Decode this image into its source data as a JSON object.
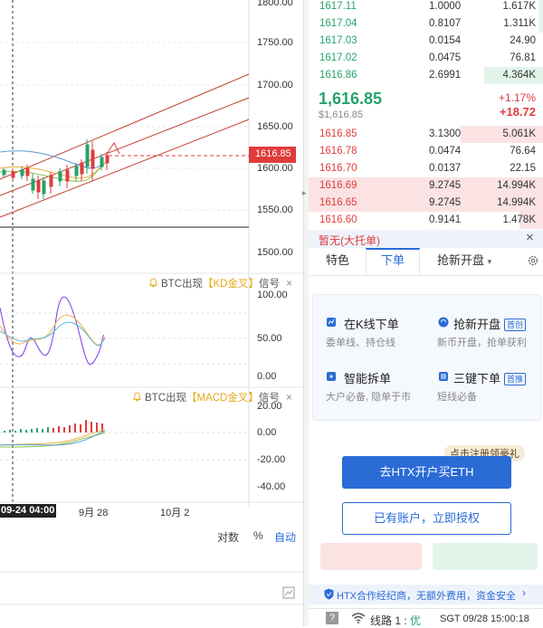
{
  "chart": {
    "price_axis": [
      "1800.00",
      "1750.00",
      "1700.00",
      "1650.00",
      "1600.00",
      "1550.00",
      "1500.00"
    ],
    "current_price_label": "1616.85",
    "kd_signal": {
      "prefix": "BTC出现",
      "highlight": "【KD金叉】",
      "suffix": "信号",
      "close": "×"
    },
    "kd_axis": [
      "100.00",
      "50.00",
      "0.00"
    ],
    "macd_signal": {
      "prefix": "BTC出现",
      "highlight": "【MACD金叉】",
      "suffix": "信号",
      "close": "×"
    },
    "macd_axis": [
      "20.00",
      "0.00",
      "-20.00",
      "-40.00"
    ],
    "time_axis": {
      "cursor": "09-24 04:00",
      "t1": "9月 28",
      "t2": "10月 2"
    },
    "controls": {
      "log": "对数",
      "pct": "%",
      "auto": "自动"
    }
  },
  "orderbook": {
    "asks_top": [
      {
        "price": "1617.11",
        "amount": "1.0000",
        "total": "1.617K",
        "fill": 0.02
      },
      {
        "price": "1617.04",
        "amount": "0.8107",
        "total": "1.311K",
        "fill": 0.02
      },
      {
        "price": "1617.03",
        "amount": "0.0154",
        "total": "24.90",
        "fill": 0.0
      },
      {
        "price": "1617.02",
        "amount": "0.0475",
        "total": "76.81",
        "fill": 0.0
      },
      {
        "price": "1616.86",
        "amount": "2.6991",
        "total": "4.364K",
        "fill": 0.25
      }
    ],
    "last_price": "1,616.85",
    "last_price_usd": "$1,616.85",
    "change_pct": "+1.17%",
    "change_abs": "+18.72",
    "bids": [
      {
        "price": "1616.85",
        "amount": "3.1300",
        "total": "5.061K",
        "fill": 0.35
      },
      {
        "price": "1616.78",
        "amount": "0.0474",
        "total": "76.64",
        "fill": 0.0
      },
      {
        "price": "1616.70",
        "amount": "0.0137",
        "total": "22.15",
        "fill": 0.0
      },
      {
        "price": "1616.69",
        "amount": "9.2745",
        "total": "14.994K",
        "fill": 1.0
      },
      {
        "price": "1616.65",
        "amount": "9.2745",
        "total": "14.994K",
        "fill": 1.0
      },
      {
        "price": "1616.60",
        "amount": "0.9141",
        "total": "1.478K",
        "fill": 0.1
      }
    ],
    "status": "暂无(大托单)"
  },
  "tabs": {
    "t1": "特色",
    "t2": "下单",
    "t3": "抢新开盘"
  },
  "features": [
    {
      "title": "在K线下单",
      "sub": "委单线、持仓线",
      "badge": ""
    },
    {
      "title": "抢新开盘",
      "sub": "新币开盘，抢单获利",
      "badge": "首创"
    },
    {
      "title": "智能拆单",
      "sub": "大户必备, 隐单于市",
      "badge": ""
    },
    {
      "title": "三键下单",
      "sub": "短线必备",
      "badge": "首推"
    }
  ],
  "promo": "点击注册领豪礼",
  "buttons": {
    "buy": "去HTX开户买ETH",
    "login": "已有账户，立即授权"
  },
  "footer_note": "HTX合作经纪商，无额外费用，资金安全",
  "statusbar": {
    "line": "线路 1 : ",
    "line_quality": "优",
    "time": "SGT  09/28 15:00:18"
  },
  "colors": {
    "up": "#26a269",
    "down": "#e03b3b",
    "accent": "#2a6bd6"
  }
}
